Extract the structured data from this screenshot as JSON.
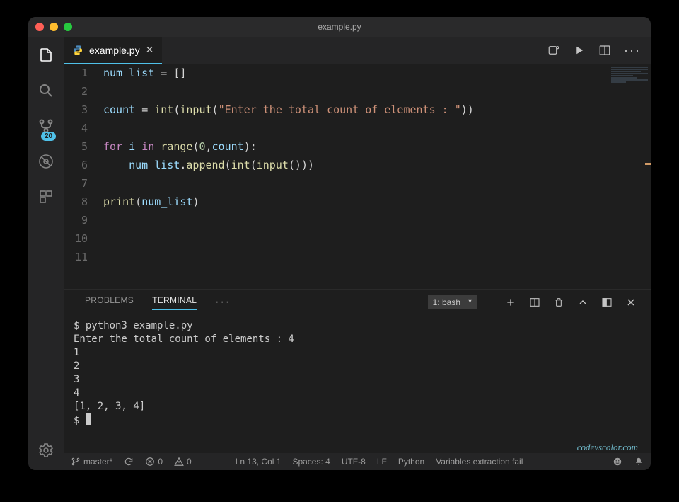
{
  "window": {
    "title": "example.py"
  },
  "activity": {
    "git_badge": "20"
  },
  "tab": {
    "filename": "example.py"
  },
  "editor": {
    "lines": [
      "num_list = []",
      "",
      "count = int(input(\"Enter the total count of elements : \"))",
      "",
      "for i in range(0,count):",
      "    num_list.append(int(input()))",
      "",
      "print(num_list)",
      "",
      "",
      ""
    ],
    "line_numbers": [
      "1",
      "2",
      "3",
      "4",
      "5",
      "6",
      "7",
      "8",
      "9",
      "10",
      "11"
    ]
  },
  "panel": {
    "tabs": {
      "problems": "PROBLEMS",
      "terminal": "TERMINAL"
    },
    "shell_label": "1: bash",
    "terminal_lines": [
      "$ python3 example.py",
      "Enter the total count of elements : 4",
      "1",
      "2",
      "3",
      "4",
      "[1, 2, 3, 4]",
      "$ "
    ],
    "watermark": "codevscolor.com"
  },
  "status": {
    "branch": "master*",
    "errors": "0",
    "warnings": "0",
    "cursor": "Ln 13, Col 1",
    "spaces": "Spaces: 4",
    "encoding": "UTF-8",
    "eol": "LF",
    "language": "Python",
    "extra": "Variables extraction fail"
  }
}
